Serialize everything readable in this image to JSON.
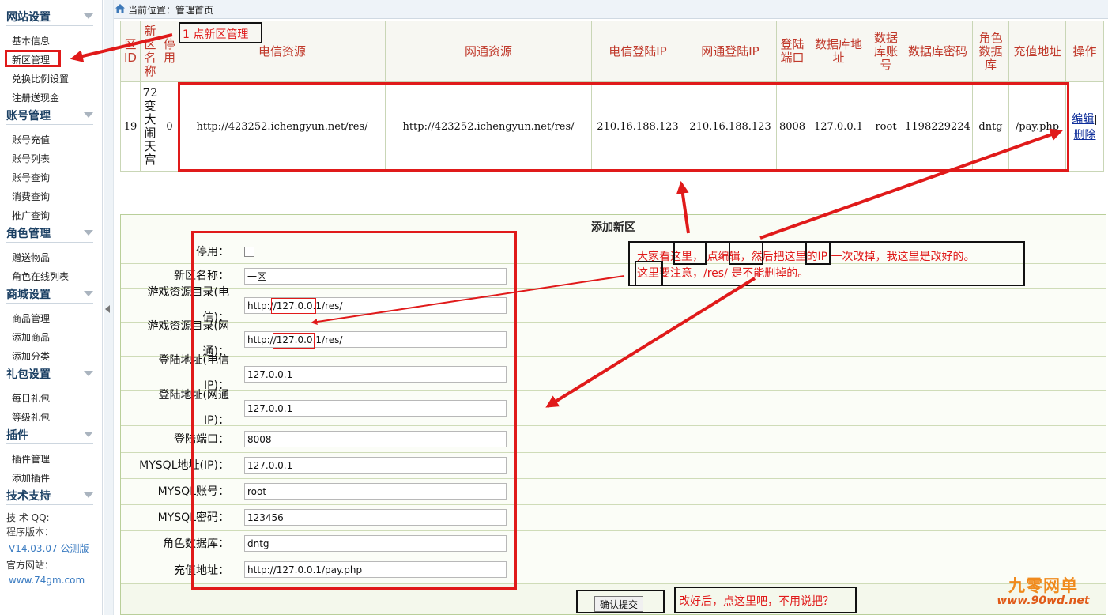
{
  "breadcrumb": "当前位置：管理首页",
  "sidebar": {
    "groups": [
      {
        "title": "网站设置",
        "items": [
          "基本信息",
          "新区管理",
          "兑换比例设置",
          "注册送现金"
        ]
      },
      {
        "title": "账号管理",
        "items": [
          "账号充值",
          "账号列表",
          "账号查询",
          "消费查询",
          "推广查询"
        ]
      },
      {
        "title": "角色管理",
        "items": [
          "赠送物品",
          "角色在线列表"
        ]
      },
      {
        "title": "商城设置",
        "items": [
          "商品管理",
          "添加商品",
          "添加分类"
        ]
      },
      {
        "title": "礼包设置",
        "items": [
          "每日礼包",
          "等级礼包"
        ]
      },
      {
        "title": "插件",
        "items": [
          "插件管理",
          "添加插件"
        ]
      },
      {
        "title": "技术支持",
        "items": []
      }
    ],
    "support": {
      "qq_label": "技 术 QQ:",
      "version_label": "程序版本：",
      "version_value": "V14.03.07 公测版",
      "site_label": "官方网站：",
      "site_value": "www.74gm.com"
    }
  },
  "zone_table": {
    "headers": [
      "区ID",
      "新区名称",
      "停用",
      "电信资源",
      "网通资源",
      "电信登陆IP",
      "网通登陆IP",
      "登陆端口",
      "数据库地址",
      "数据库账号",
      "数据库密码",
      "角色数据库",
      "充值地址",
      "操作"
    ],
    "row": {
      "id": "19",
      "name": "72变大闹天宫",
      "disabled": "0",
      "telecom_res": "http://423252.ichengyun.net/res/",
      "netcom_res": "http://423252.ichengyun.net/res/",
      "telecom_ip": "210.16.188.123",
      "netcom_ip": "210.16.188.123",
      "port": "8008",
      "db_addr": "127.0.0.1",
      "db_user": "root",
      "db_pass": "1198229224",
      "role_db": "dntg",
      "pay_url": "/pay.php",
      "edit": "编辑",
      "delete": "删除"
    }
  },
  "add_form": {
    "title": "添加新区",
    "labels": {
      "disabled": "停用：",
      "name": "新区名称：",
      "telecom_res_1": "游戏资源目录(电",
      "telecom_res_2": "信)：",
      "netcom_res_1": "游戏资源目录(网",
      "netcom_res_2": "通)：",
      "telecom_ip_1": "登陆地址(电信",
      "telecom_ip_2": "IP)：",
      "netcom_ip_1": "登陆地址(网通",
      "netcom_ip_2": "IP)：",
      "port": "登陆端口：",
      "mysql_addr": "MYSQL地址(IP)：",
      "mysql_user": "MYSQL账号：",
      "mysql_pass": "MYSQL密码：",
      "role_db": "角色数据库：",
      "pay_url": "充值地址："
    },
    "values": {
      "name": "一区",
      "telecom_res": "http://127.0.0.1/res/",
      "netcom_res": "http://127.0.0.1/res/",
      "telecom_ip": "127.0.0.1",
      "netcom_ip": "127.0.0.1",
      "port": "8008",
      "mysql_addr": "127.0.0.1",
      "mysql_user": "root",
      "mysql_pass": "123456",
      "role_db": "dntg",
      "pay_url": "http://127.0.0.1/pay.php"
    },
    "submit": "确认提交"
  },
  "annotations": {
    "step1": "1 点新区管理",
    "note_line1": "大家看这里，  点编辑，然后把这里的IP 一次改掉，我这里是改好的。",
    "note_line2": "这里要注意，/res/ 是不能删掉的。",
    "submit_note": "改好后，点这里吧，不用说把？"
  },
  "watermark": {
    "brand": "九零网单",
    "url": "www.90wd.net"
  },
  "colors": {
    "annotation_red": "#e01a1a",
    "header_red": "#c0392b",
    "sidebar_title": "#1a3f63"
  }
}
